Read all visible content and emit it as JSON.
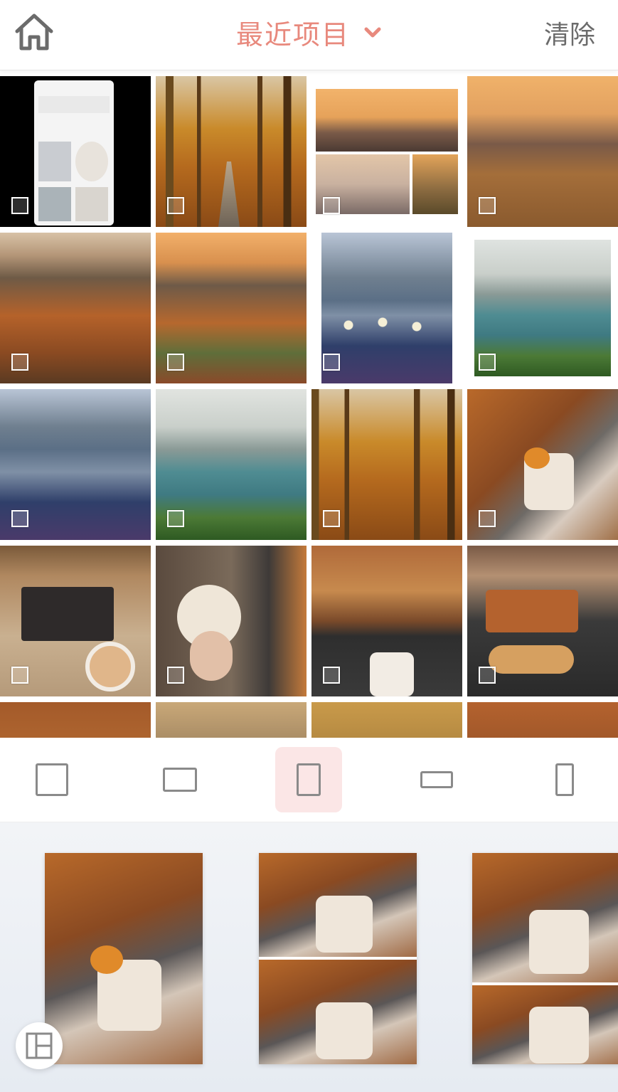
{
  "header": {
    "title": "最近项目",
    "clear_label": "清除",
    "accent": "#e8897d"
  },
  "icons": {
    "home": "home-icon",
    "dropdown": "chevron-down-icon",
    "layout": "layout-grid-icon"
  },
  "grid": {
    "thumbnails": [
      "app-screenshot",
      "autumn-forest-path",
      "toronto-skyline-collage",
      "city-sunset-aerial",
      "autumn-city-aerial",
      "autumn-neighborhood-aerial",
      "lake-flowers",
      "lake-meadow",
      "lake-flowers",
      "lake-meadow",
      "autumn-forest-path",
      "pumpkin-mug-window",
      "hello-fall-doormat",
      "november-morning-coffee",
      "car-dashboard-mug",
      "car-croissant",
      "autumn-trees",
      "movie-scene",
      "autumn-road",
      "car-rear-window"
    ]
  },
  "formats": [
    "square",
    "landscape",
    "portrait",
    "wide",
    "tall"
  ],
  "selected_format": "portrait",
  "previews": [
    {
      "name": "single",
      "pieces": 1
    },
    {
      "name": "split-two",
      "pieces": 2
    },
    {
      "name": "split-uneven",
      "pieces": 2
    }
  ]
}
